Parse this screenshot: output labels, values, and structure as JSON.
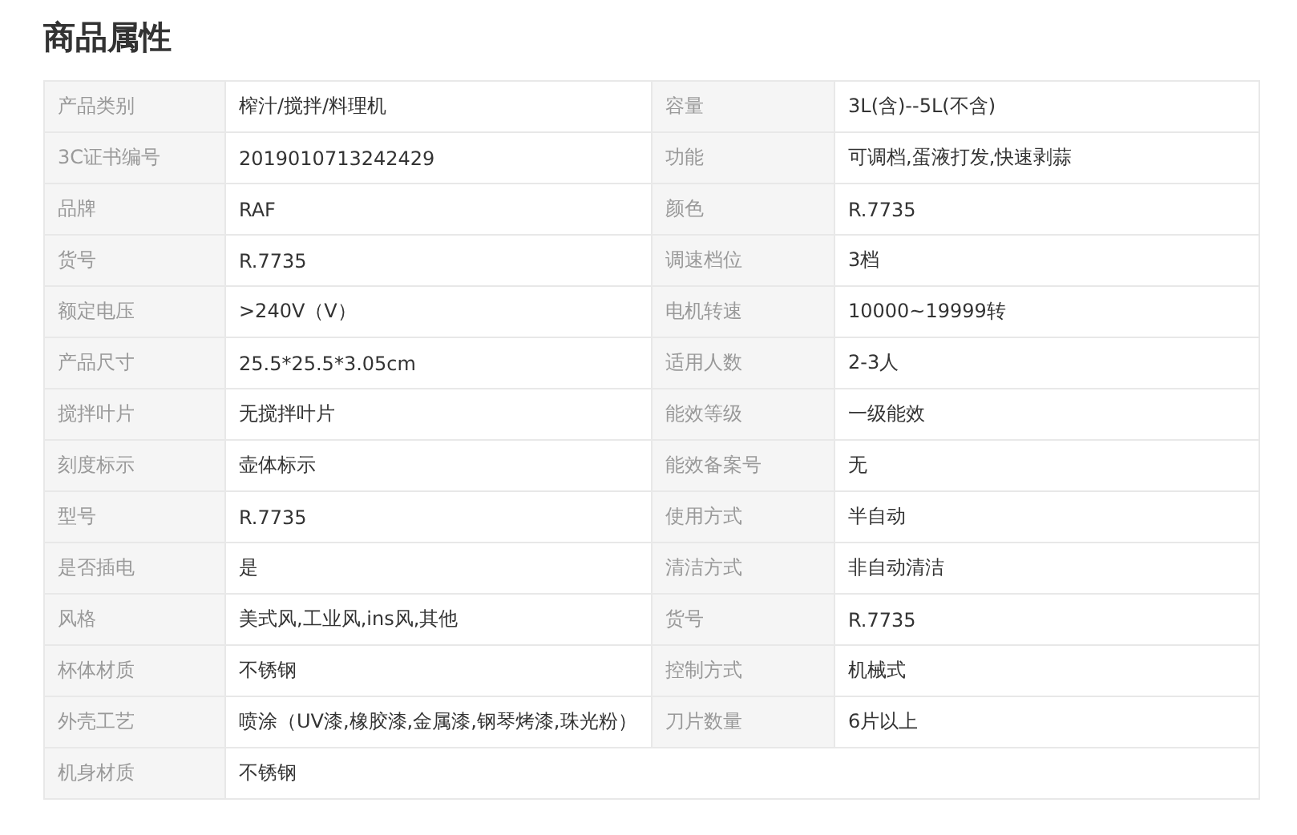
{
  "title": "商品属性",
  "rows": [
    [
      {
        "label": "产品类别",
        "value": "榨汁/搅拌/料理机"
      },
      {
        "label": "容量",
        "value": "3L(含)--5L(不含)"
      }
    ],
    [
      {
        "label": "3C证书编号",
        "value": "2019010713242429"
      },
      {
        "label": "功能",
        "value": "可调档,蛋液打发,快速剥蒜"
      }
    ],
    [
      {
        "label": "品牌",
        "value": "RAF"
      },
      {
        "label": "颜色",
        "value": "R.7735"
      }
    ],
    [
      {
        "label": "货号",
        "value": "R.7735"
      },
      {
        "label": "调速档位",
        "value": "3档"
      }
    ],
    [
      {
        "label": "额定电压",
        "value": ">240V（V）"
      },
      {
        "label": "电机转速",
        "value": "10000~19999转"
      }
    ],
    [
      {
        "label": "产品尺寸",
        "value": "25.5*25.5*3.05cm"
      },
      {
        "label": "适用人数",
        "value": "2-3人"
      }
    ],
    [
      {
        "label": "搅拌叶片",
        "value": "无搅拌叶片"
      },
      {
        "label": "能效等级",
        "value": "一级能效"
      }
    ],
    [
      {
        "label": "刻度标示",
        "value": "壶体标示"
      },
      {
        "label": "能效备案号",
        "value": "无"
      }
    ],
    [
      {
        "label": "型号",
        "value": "R.7735"
      },
      {
        "label": "使用方式",
        "value": "半自动"
      }
    ],
    [
      {
        "label": "是否插电",
        "value": "是"
      },
      {
        "label": "清洁方式",
        "value": "非自动清洁"
      }
    ],
    [
      {
        "label": "风格",
        "value": "美式风,工业风,ins风,其他"
      },
      {
        "label": "货号",
        "value": "R.7735"
      }
    ],
    [
      {
        "label": "杯体材质",
        "value": "不锈钢"
      },
      {
        "label": "控制方式",
        "value": "机械式"
      }
    ],
    [
      {
        "label": "外壳工艺",
        "value": "喷涂（UV漆,橡胶漆,金属漆,钢琴烤漆,珠光粉）"
      },
      {
        "label": "刀片数量",
        "value": "6片以上"
      }
    ],
    [
      {
        "label": "机身材质",
        "value": "不锈钢"
      }
    ]
  ]
}
